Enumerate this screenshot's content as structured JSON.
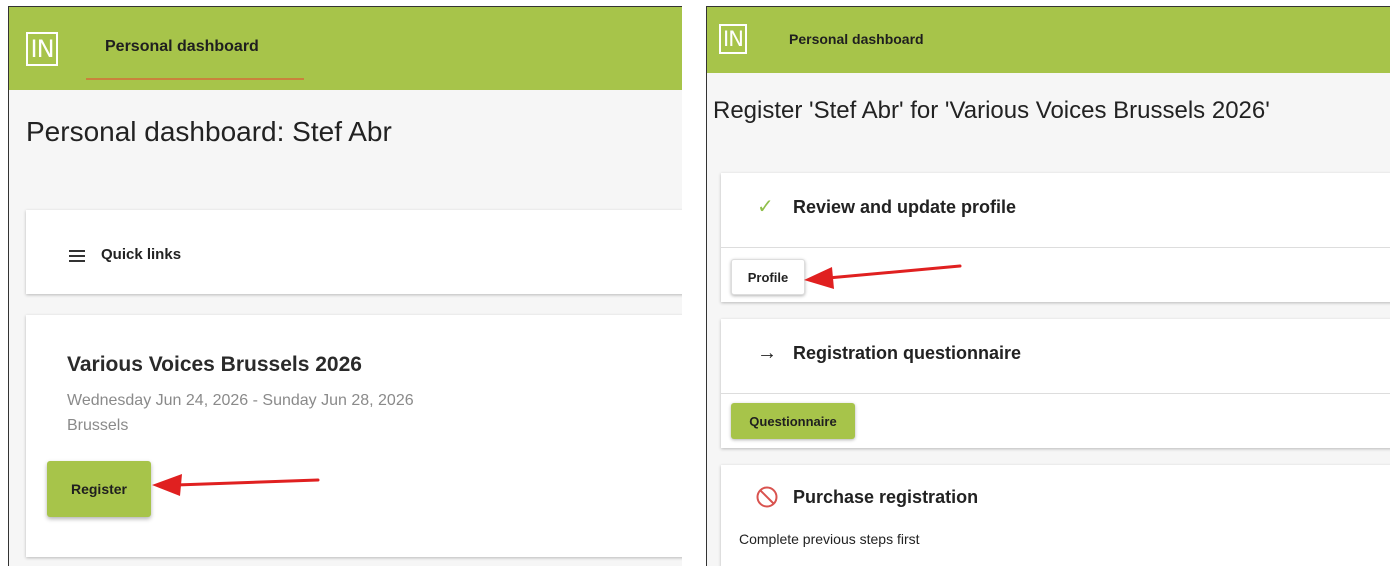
{
  "left_panel": {
    "logo_text": "IN",
    "nav_tab": "Personal dashboard",
    "page_title": "Personal dashboard: Stef Abr",
    "quick_links": {
      "icon": "menu-icon",
      "label": "Quick links"
    },
    "event": {
      "title": "Various Voices Brussels 2026",
      "dates": "Wednesday Jun 24, 2026 - Sunday Jun 28, 2026",
      "city": "Brussels",
      "register_label": "Register"
    }
  },
  "right_panel": {
    "logo_text": "IN",
    "nav_tab": "Personal dashboard",
    "page_title": "Register 'Stef Abr' for 'Various Voices Brussels 2026'",
    "steps": [
      {
        "icon": "check-icon",
        "icon_glyph": "✓",
        "title": "Review and update profile",
        "button_label": "Profile"
      },
      {
        "icon": "arrow-right-icon",
        "icon_glyph": "→",
        "title": "Registration questionnaire",
        "button_label": "Questionnaire"
      },
      {
        "icon": "blocked-icon",
        "title": "Purchase registration",
        "note": "Complete previous steps first"
      }
    ]
  },
  "colors": {
    "brand_green": "#a7c44a",
    "tab_underline": "#c9823c",
    "check_green": "#8fbf4a",
    "blocked_red": "#d9534f",
    "annotation_arrow": "#e02020"
  }
}
